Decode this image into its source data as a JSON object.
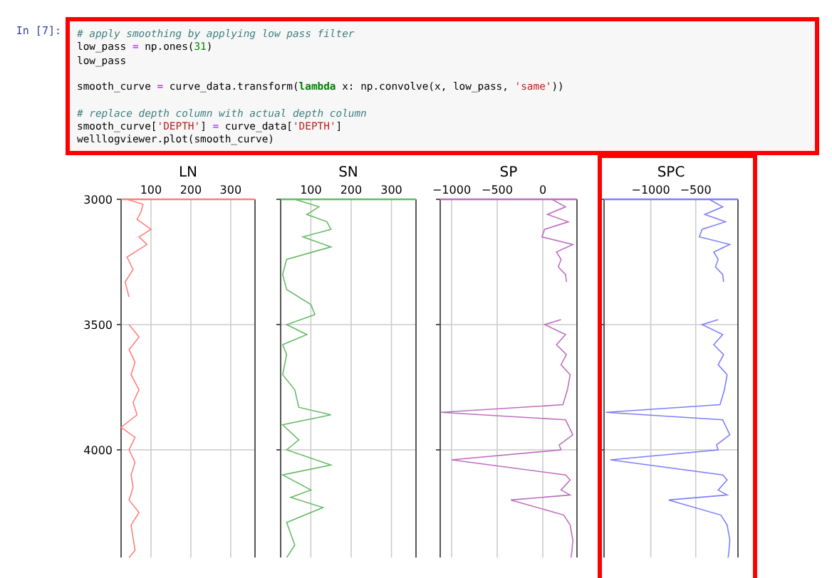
{
  "cell": {
    "prompt": "In [7]:",
    "highlighted": true,
    "lines": [
      {
        "kind": "code",
        "tokens": [
          {
            "text": "# apply smoothing by applying low pass filter",
            "kind": "comment"
          }
        ]
      },
      {
        "kind": "code",
        "tokens": [
          {
            "text": "low_pass ",
            "kind": "plain"
          },
          {
            "text": "=",
            "kind": "operator"
          },
          {
            "text": " np.ones(",
            "kind": "plain"
          },
          {
            "text": "31",
            "kind": "number"
          },
          {
            "text": ")",
            "kind": "plain"
          }
        ]
      },
      {
        "kind": "code",
        "tokens": [
          {
            "text": "low_pass",
            "kind": "plain"
          }
        ]
      },
      {
        "kind": "blank"
      },
      {
        "kind": "code",
        "tokens": [
          {
            "text": "smooth_curve ",
            "kind": "plain"
          },
          {
            "text": "=",
            "kind": "operator"
          },
          {
            "text": " curve_data.transform(",
            "kind": "plain"
          },
          {
            "text": "lambda",
            "kind": "keyword"
          },
          {
            "text": " x: np.convolve(x, low_pass, ",
            "kind": "plain"
          },
          {
            "text": "'same'",
            "kind": "string"
          },
          {
            "text": "))",
            "kind": "plain"
          }
        ]
      },
      {
        "kind": "blank"
      },
      {
        "kind": "code",
        "tokens": [
          {
            "text": "# replace depth column with actual depth column",
            "kind": "comment"
          }
        ]
      },
      {
        "kind": "code",
        "tokens": [
          {
            "text": "smooth_curve[",
            "kind": "plain"
          },
          {
            "text": "'DEPTH'",
            "kind": "string"
          },
          {
            "text": "] ",
            "kind": "plain"
          },
          {
            "text": "=",
            "kind": "operator"
          },
          {
            "text": " curve_data[",
            "kind": "plain"
          },
          {
            "text": "'DEPTH'",
            "kind": "string"
          },
          {
            "text": "]",
            "kind": "plain"
          }
        ]
      },
      {
        "kind": "code",
        "tokens": [
          {
            "text": "welllogviewer.plot(smooth_curve)",
            "kind": "plain"
          }
        ]
      }
    ]
  },
  "figure": {
    "depth_ticks": [
      "3000",
      "3500",
      "4000"
    ],
    "tracks": [
      {
        "title": "LN",
        "color": "#ff7f7f",
        "xticks": [
          "100",
          "200",
          "300"
        ],
        "highlighted": false
      },
      {
        "title": "SN",
        "color": "#66bb66",
        "xticks": [
          "100",
          "200",
          "300"
        ],
        "highlighted": false
      },
      {
        "title": "SP",
        "color": "#bf6fbf",
        "xticks": [
          "−1000",
          "−500",
          "0"
        ],
        "highlighted": false
      },
      {
        "title": "SPC",
        "color": "#7f7fff",
        "xticks": [
          "−1000",
          "−500"
        ],
        "highlighted": true
      }
    ]
  }
}
